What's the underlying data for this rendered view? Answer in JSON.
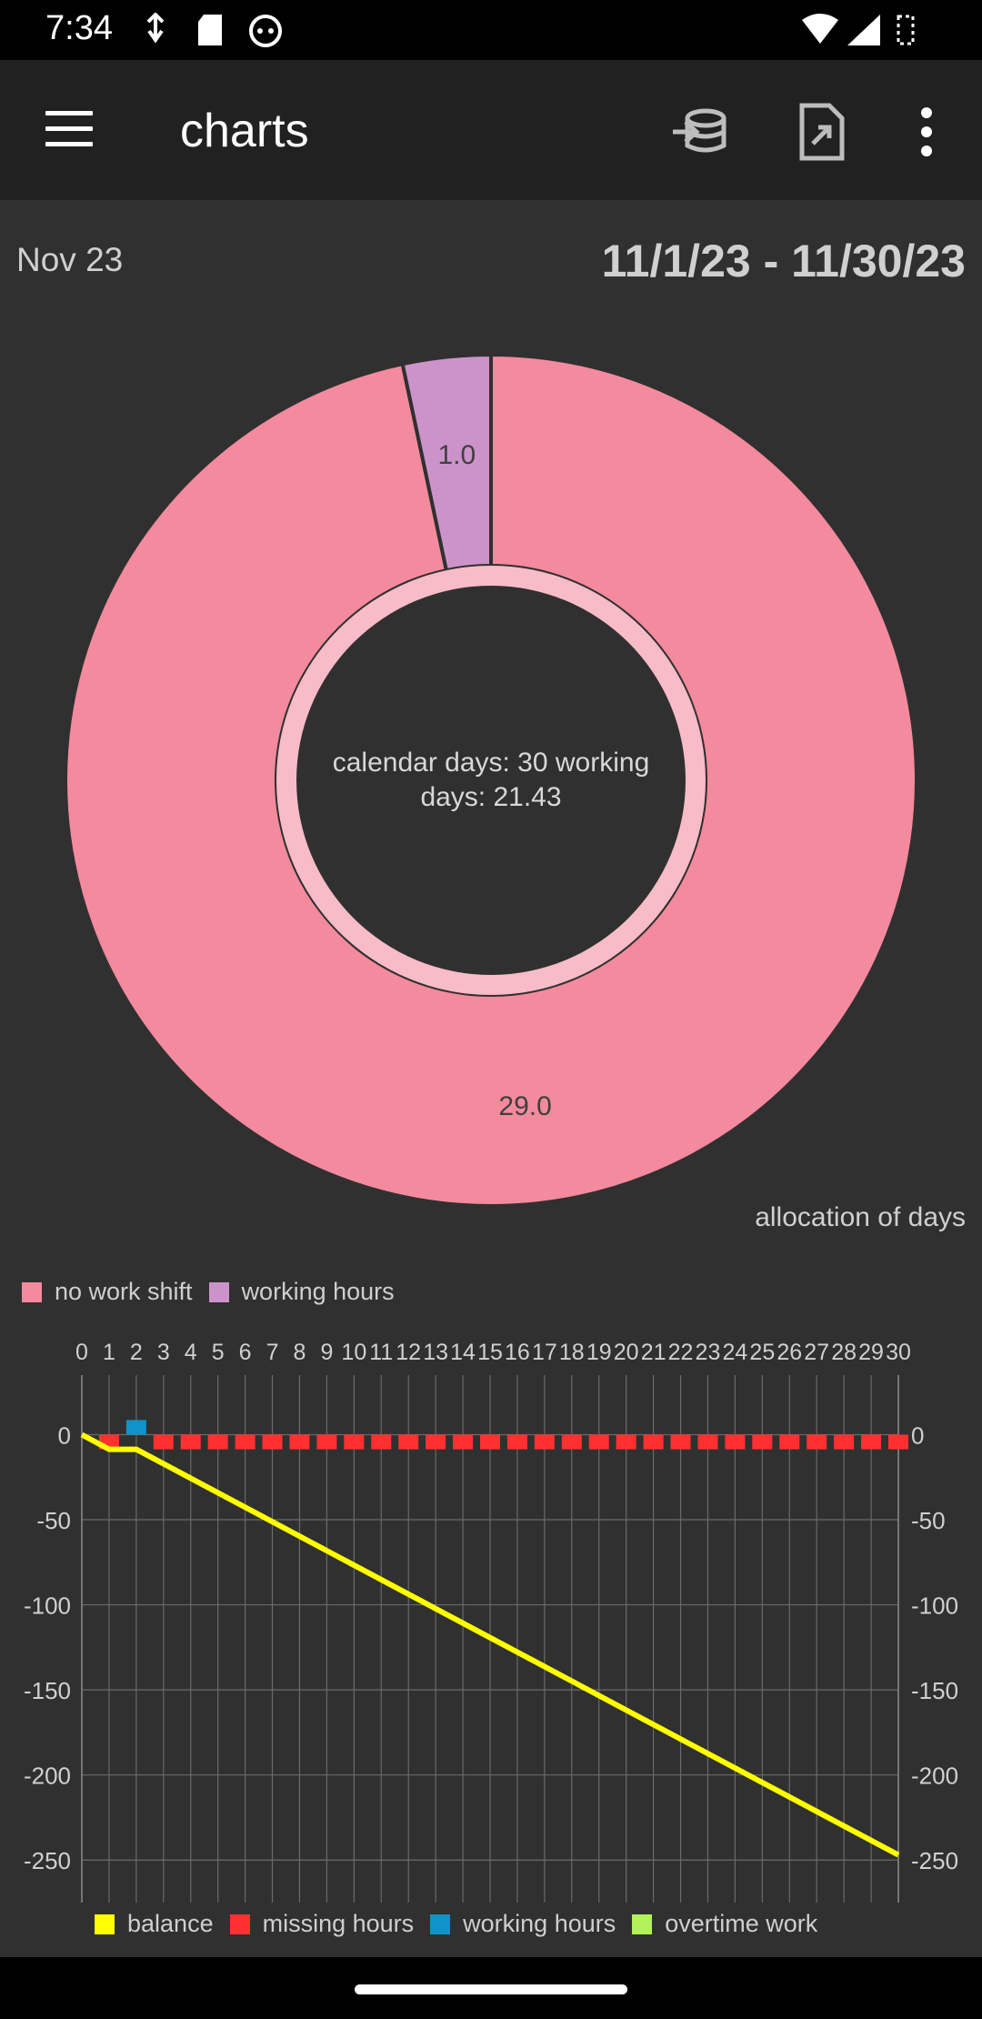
{
  "status_bar": {
    "time": "7:34"
  },
  "app_bar": {
    "title": "charts"
  },
  "header": {
    "period": "Nov 23",
    "range": "11/1/23 - 11/30/23"
  },
  "colors": {
    "no_work_shift": "#f48a9d",
    "working_hours_pie": "#cc93cb",
    "balance": "#ffff00",
    "missing_hours": "#ff3030",
    "working_hours_bar": "#0e94c8",
    "overtime_work": "#b2f25a",
    "inner_ring": "#f7bcc8"
  },
  "chart_data": [
    {
      "type": "pie",
      "center_text": "calendar days: 30 working\ndays: 21.43",
      "description": "allocation of days",
      "slices": [
        {
          "label": "no work shift",
          "value": 29.0,
          "value_label": "29.0"
        },
        {
          "label": "working hours",
          "value": 1.0,
          "value_label": "1.0"
        }
      ],
      "legend": [
        "no work shift",
        "working hours"
      ]
    },
    {
      "type": "bar",
      "x": [
        0,
        1,
        2,
        3,
        4,
        5,
        6,
        7,
        8,
        9,
        10,
        11,
        12,
        13,
        14,
        15,
        16,
        17,
        18,
        19,
        20,
        21,
        22,
        23,
        24,
        25,
        26,
        27,
        28,
        29,
        30
      ],
      "x_tick_labels": [
        "0",
        "1",
        "2",
        "3",
        "4",
        "5",
        "6",
        "7",
        "8",
        "9",
        "10",
        "11",
        "12",
        "13",
        "14",
        "15",
        "16",
        "17",
        "18",
        "19",
        "20",
        "21",
        "22",
        "23",
        "24",
        "25",
        "26",
        "27",
        "28",
        "29",
        "30"
      ],
      "ylim": [
        -275,
        35
      ],
      "y_ticks": [
        0,
        -50,
        -100,
        -150,
        -200,
        -250
      ],
      "y_tick_labels": [
        "0",
        "-50",
        "-100",
        "-150",
        "-200",
        "-250"
      ],
      "legend": [
        "balance",
        "missing hours",
        "working hours",
        "overtime work"
      ],
      "series": [
        {
          "name": "balance",
          "type": "line",
          "x": [
            0,
            1,
            2,
            30
          ],
          "values": [
            0,
            -8.6,
            -8.6,
            -247
          ]
        },
        {
          "name": "missing hours",
          "type": "bar",
          "x": [
            1,
            3,
            4,
            5,
            6,
            7,
            8,
            9,
            10,
            11,
            12,
            13,
            14,
            15,
            16,
            17,
            18,
            19,
            20,
            21,
            22,
            23,
            24,
            25,
            26,
            27,
            28,
            29,
            30
          ],
          "values": [
            -8.6,
            -8.6,
            -8.6,
            -8.6,
            -8.6,
            -8.6,
            -8.6,
            -8.6,
            -8.6,
            -8.6,
            -8.6,
            -8.6,
            -8.6,
            -8.6,
            -8.6,
            -8.6,
            -8.6,
            -8.6,
            -8.6,
            -8.6,
            -8.6,
            -8.6,
            -8.6,
            -8.6,
            -8.6,
            -8.6,
            -8.6,
            -8.6,
            -8.6
          ]
        },
        {
          "name": "working hours",
          "type": "bar",
          "x": [
            2
          ],
          "values": [
            8.6
          ]
        },
        {
          "name": "overtime work",
          "type": "bar",
          "x": [],
          "values": []
        }
      ]
    }
  ]
}
